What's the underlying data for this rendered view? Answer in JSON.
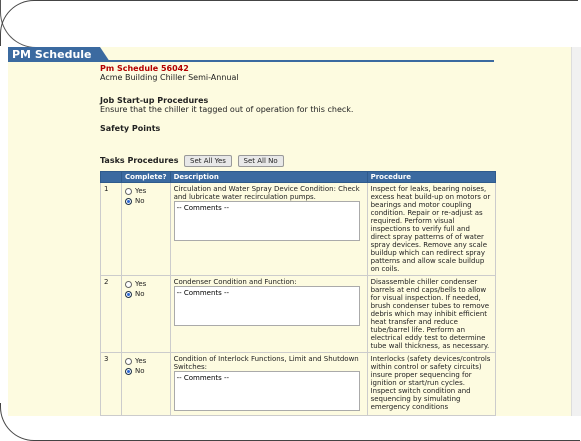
{
  "window": {
    "title": "PM Schedule"
  },
  "schedule": {
    "id_label": "Pm Schedule 56042",
    "subtitle": "Acme Building Chiller Semi-Annual"
  },
  "startup": {
    "title": "Job Start-up Procedures",
    "text": "Ensure that the chiller it tagged out of operation for this check."
  },
  "safety": {
    "title": "Safety Points"
  },
  "tasks": {
    "title": "Tasks Procedures",
    "set_yes": "Set All Yes",
    "set_no": "Set All No",
    "headers": {
      "complete": "Complete?",
      "description": "Description",
      "procedure": "Procedure"
    },
    "rows": [
      {
        "num": "1",
        "yes": "Yes",
        "no": "No",
        "selected": "No",
        "description": "Circulation and Water Spray Device Condition: Check and lubricate water recirculation pumps.",
        "comments": "-- Comments --",
        "procedure": "Inspect for leaks, bearing noises, excess heat build-up on motors or bearings and motor coupling condition. Repair or re-adjust as required. Perform visual inspections to verify full and direct spray patterns of of water spray devices. Remove any scale buildup which can redirect spray patterns and allow scale buildup on coils."
      },
      {
        "num": "2",
        "yes": "Yes",
        "no": "No",
        "selected": "No",
        "description": "Condenser Condition and Function:",
        "comments": "-- Comments --",
        "procedure": "Disassemble chiller condenser barrels at end caps/bells to allow for visual inspection. If needed, brush condenser tubes to remove debris which may inhibit efficient heat transfer and reduce tube/barrel life. Perform an electrical eddy test to determine tube wall thickness, as necessary."
      },
      {
        "num": "3",
        "yes": "Yes",
        "no": "No",
        "selected": "No",
        "description": "Condition of Interlock Functions, Limit and Shutdown Switches:",
        "comments": "-- Comments --",
        "procedure": "Interlocks (safety devices/controls within control or safety circuits) insure proper sequencing for ignition or start/run cycles. Inspect switch condition and sequencing by simulating emergency conditions"
      }
    ]
  }
}
